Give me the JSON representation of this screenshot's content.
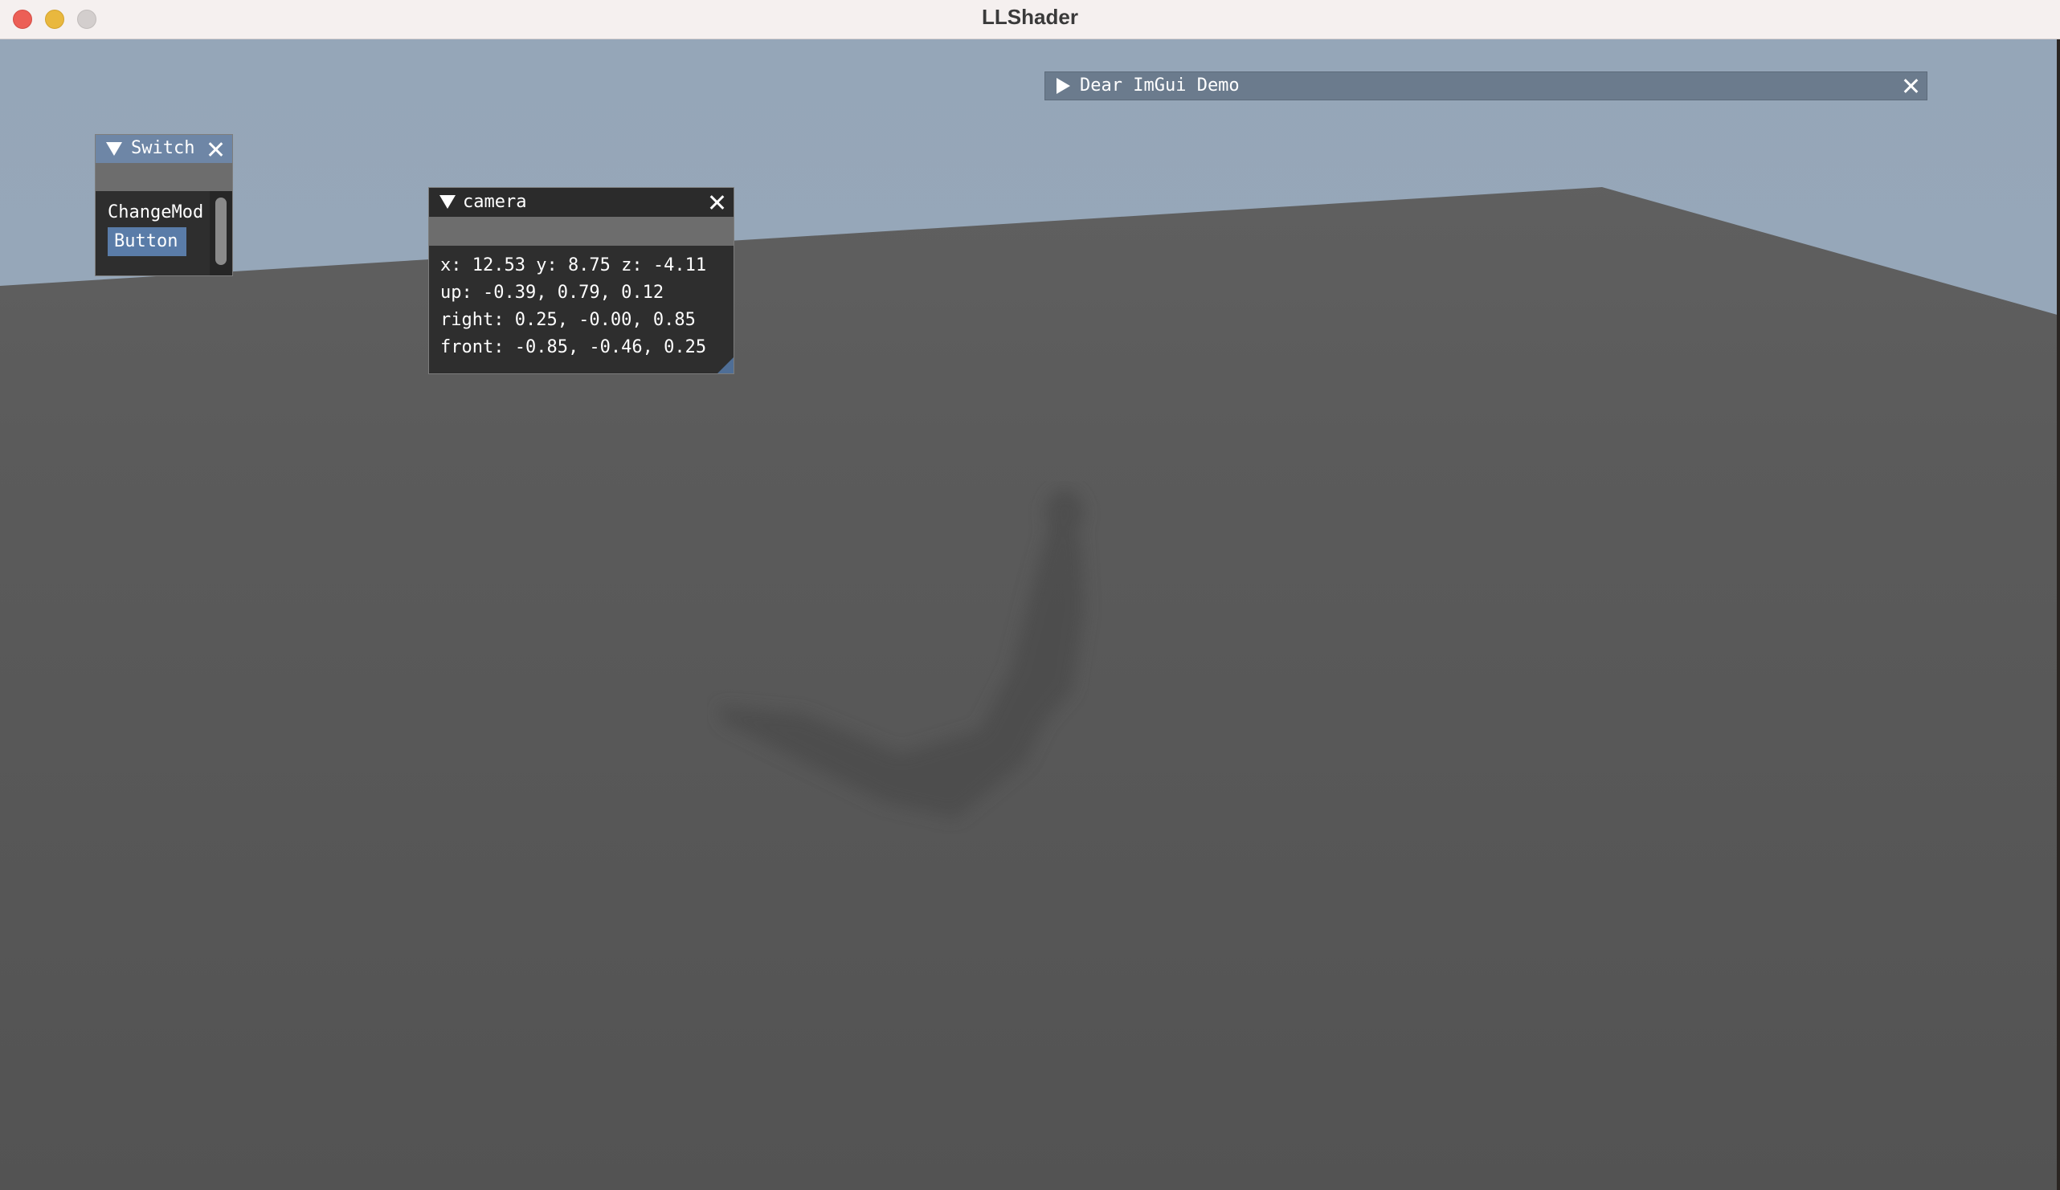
{
  "app": {
    "title": "LLShader"
  },
  "windows": {
    "switch": {
      "title": "Switch",
      "item_label": "ChangeMod",
      "button_label": "Button"
    },
    "camera": {
      "title": "camera",
      "lines": [
        "x: 12.53 y: 8.75 z: -4.11",
        "up: -0.39, 0.79, 0.12",
        "right: 0.25, -0.00, 0.85",
        "front: -0.85, -0.46, 0.25"
      ]
    },
    "demo": {
      "title": "Dear ImGui Demo"
    }
  },
  "icons": {
    "collapse_open": "triangle-down-icon",
    "collapse_closed": "triangle-right-icon",
    "close": "close-icon"
  },
  "colors": {
    "imgui_title_active": "#2f5f96",
    "imgui_title_inactive": "#6b7b8d",
    "imgui_window_bg": "#2e2e2e",
    "imgui_button": "#5a7ca8",
    "sky": "#95a6b8",
    "floor": "#5b5b5b"
  }
}
